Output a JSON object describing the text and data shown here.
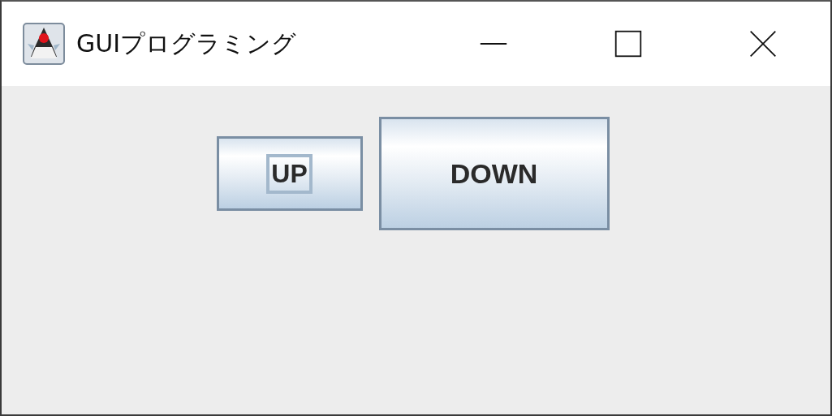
{
  "window": {
    "title": "GUIプログラミング"
  },
  "buttons": [
    {
      "label": "UP",
      "focused": true
    },
    {
      "label": "DOWN",
      "focused": false
    }
  ]
}
